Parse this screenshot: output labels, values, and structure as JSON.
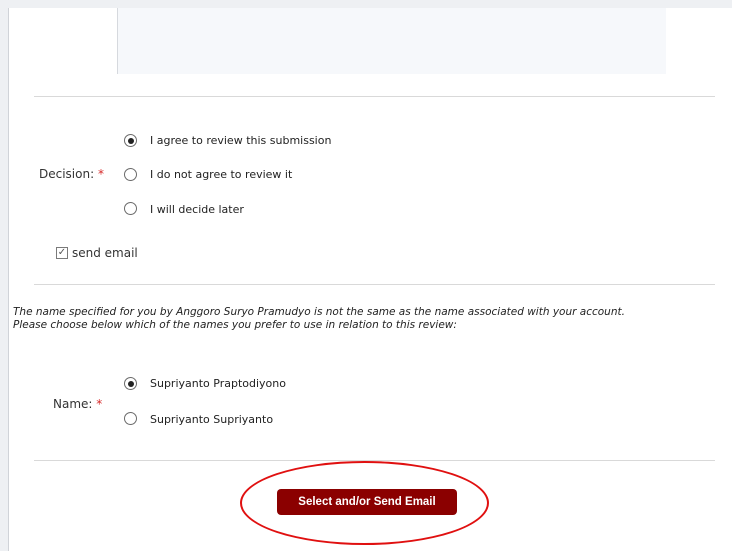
{
  "decision": {
    "label": "Decision:",
    "required_mark": "*",
    "options": [
      {
        "label": "I agree to review this submission",
        "checked": true
      },
      {
        "label": "I do not agree to review it",
        "checked": false
      },
      {
        "label": "I will decide later",
        "checked": false
      }
    ]
  },
  "send_email": {
    "label": "send email",
    "checked": true
  },
  "notice": {
    "line1": "The name specified for you by Anggoro Suryo Pramudyo is not the same as the name associated with your account.",
    "line2": "Please choose below which of the names you prefer to use in relation to this review:"
  },
  "name": {
    "label": "Name:",
    "required_mark": "*",
    "options": [
      {
        "label": "Supriyanto Praptodiyono",
        "checked": true
      },
      {
        "label": "Supriyanto Supriyanto",
        "checked": false
      }
    ]
  },
  "submit": {
    "label": "Select and/or Send Email"
  },
  "colors": {
    "button": "#8b0000",
    "required": "#d62828",
    "highlight": "#e01010"
  }
}
